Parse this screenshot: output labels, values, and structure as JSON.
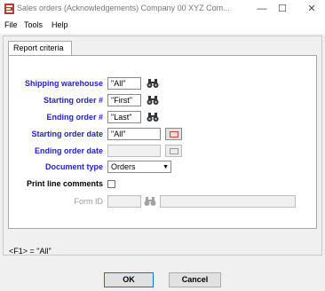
{
  "window": {
    "title": "Sales orders (Acknowledgements)     Company 00  XYZ Com...",
    "minimize": "—",
    "maximize": "☐",
    "close": "✕"
  },
  "menu": {
    "items": [
      "File",
      "Tools",
      "Help"
    ]
  },
  "tab": {
    "label": "Report criteria"
  },
  "form": {
    "shipping_warehouse": {
      "label": "Shipping warehouse",
      "value": "\"All\""
    },
    "starting_order": {
      "label": "Starting order #",
      "value": "\"First\""
    },
    "ending_order": {
      "label": "Ending order #",
      "value": "\"Last\""
    },
    "starting_order_date": {
      "label": "Starting order date",
      "value": "\"All\""
    },
    "ending_order_date": {
      "label": "Ending order date",
      "value": ""
    },
    "document_type": {
      "label": "Document type",
      "value": "Orders"
    },
    "print_line_comments": {
      "label": "Print line comments",
      "checked": false
    },
    "form_id": {
      "label": "Form ID",
      "value": "",
      "description": ""
    }
  },
  "status": {
    "hint": "<F1> = \"All\""
  },
  "buttons": {
    "ok": "OK",
    "cancel": "Cancel"
  },
  "icons": {
    "app": "app-icon",
    "lookup": "binoculars-icon",
    "calendar": "calendar-icon",
    "dropdown": "chevron-down-icon"
  },
  "colors": {
    "label_blue": "#2323c9",
    "ok_border": "#0078d7"
  }
}
